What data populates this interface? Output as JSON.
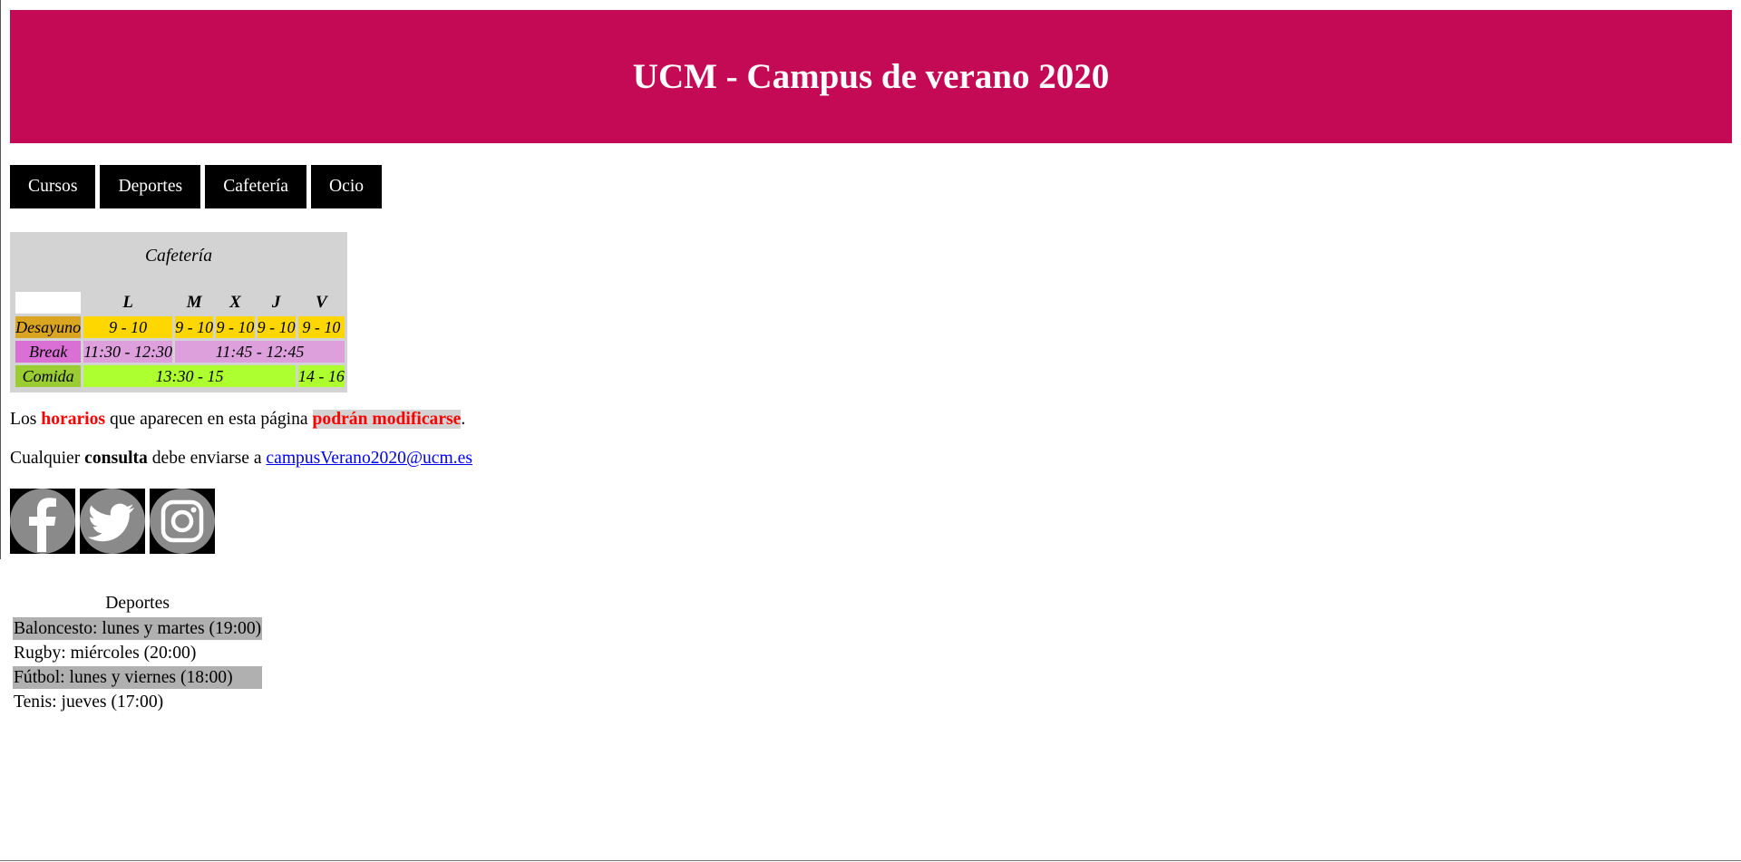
{
  "header": {
    "title": "UCM - Campus de verano 2020"
  },
  "nav": [
    "Cursos",
    "Deportes",
    "Cafetería",
    "Ocio"
  ],
  "cafeteria": {
    "caption": "Cafetería",
    "days": [
      "L",
      "M",
      "X",
      "J",
      "V"
    ],
    "rows": {
      "desayuno": {
        "label": "Desayuno",
        "cells": [
          "9 - 10",
          "9 - 10",
          "9 - 10",
          "9 - 10",
          "9 - 10"
        ]
      },
      "break": {
        "label": "Break",
        "cells": [
          "11:30 - 12:30",
          "11:45 - 12:45"
        ]
      },
      "comida": {
        "label": "Comida",
        "cells": [
          "13:30 - 15",
          "14 - 16"
        ]
      }
    },
    "colors": {
      "header_bg": "#d3d3d3",
      "desayuno_label": "#daa520",
      "desayuno": "#ffd700",
      "break_label": "#da70d6",
      "break": "#dda0dd",
      "comida_label": "#9acd32",
      "comida": "#adff2f"
    }
  },
  "notice": {
    "p1": {
      "t1": "Los ",
      "t2": "horarios",
      "t3": " que aparecen en esta página ",
      "t4": "podrán modificarse",
      "t5": "."
    },
    "p2": {
      "t1": "Cualquier ",
      "t2": "consulta",
      "t3": " debe enviarse a ",
      "email": "campusVerano2020@ucm.es"
    }
  },
  "social": [
    "facebook-icon",
    "twitter-icon",
    "instagram-icon"
  ],
  "sports": {
    "caption": "Deportes",
    "items": [
      "Baloncesto: lunes y martes (19:00)",
      "Rugby: miércoles (20:00)",
      "Fútbol: lunes y viernes (18:00)",
      "Tenis: jueves (17:00)"
    ]
  },
  "colors": {
    "banner": "#c40a55",
    "nav_bg": "#000000",
    "link": "#0000ee",
    "emphasis": "#ff0000"
  }
}
